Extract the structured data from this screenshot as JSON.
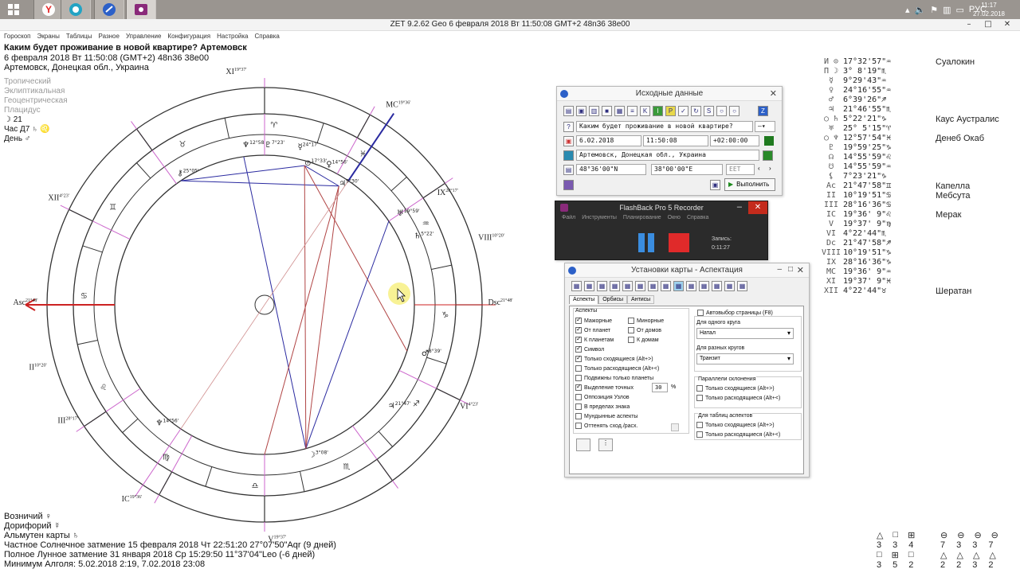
{
  "taskbar": {
    "start_icon": "windows-logo",
    "apps": [
      "yandex-browser",
      "globe-app",
      "zet-app",
      "flashback-recorder"
    ],
    "tray_lang": "РУС",
    "time": "11:17",
    "date": "27.02.2018"
  },
  "window": {
    "title": "ZET 9.2.62 Geo     6 февраля 2018  Вт  11:50:08 GMT+2 48n36  38e00",
    "minimize": "–",
    "maximize": "□",
    "close": "✕"
  },
  "menu": [
    "Гороскоп",
    "Экраны",
    "Таблицы",
    "Разное",
    "Управление",
    "Конфигурация",
    "Настройка",
    "Справка"
  ],
  "header": {
    "question": "Каким будет проживание в новой квартире? Артемовск",
    "datetime": "6 февраля 2018  Вт  11:50:08 (GMT+2) 48n36  38e00",
    "place": "Артемовск, Донецкая обл., Украина"
  },
  "settings_list": [
    "Тропический",
    "Эклиптикальная",
    "Геоцентрическая",
    "Плацидус"
  ],
  "info_list": [
    "☽  21",
    "Час Д7  ♄  ♌",
    "День  ♂"
  ],
  "bottom_list": [
    "Возничий  ♀",
    "Дорифорий  ☿",
    "Альмутен карты  ♄",
    "Частное Солнечное затмение 15 февраля 2018 Чт 22:51:20 27°07'50\"Aqr (9 дней)",
    "Полное Лунное затмение 31 января 2018 Ср 15:29:50 11°37'04\"Leo (-6 дней)",
    "Минимум Алголя: 5.02.2018  2:19,  7.02.2018 23:08"
  ],
  "wheel": {
    "houses": [
      {
        "label": "XI",
        "deg": "19°37'"
      },
      {
        "label": "MC",
        "deg": "19°36'"
      },
      {
        "label": "IX",
        "deg": "28°17'"
      },
      {
        "label": "VIII",
        "deg": "10°20'"
      },
      {
        "label": "Dsc",
        "deg": "21°48'"
      },
      {
        "label": "VI",
        "deg": "4°23'"
      },
      {
        "label": "V",
        "deg": "19°37'"
      },
      {
        "label": "IC",
        "deg": "19°36'"
      },
      {
        "label": "III",
        "deg": "28°17'"
      },
      {
        "label": "II",
        "deg": "10°20'"
      },
      {
        "label": "Asc",
        "deg": "21°48'"
      },
      {
        "label": "XII",
        "deg": "4°23'"
      }
    ],
    "planet_labels": [
      {
        "sym": "♆",
        "deg": "12°58"
      },
      {
        "sym": "♇",
        "deg": "7°23'"
      },
      {
        "sym": "☿",
        "deg": "24°17'"
      },
      {
        "sym": "♀",
        "deg": "14°56'"
      },
      {
        "sym": "⊙",
        "deg": "17°33'"
      },
      {
        "sym": "♃",
        "deg": "9°30'"
      },
      {
        "sym": "♅",
        "deg": "19°59'"
      },
      {
        "sym": "♄",
        "deg": "5°22'"
      },
      {
        "sym": "♂",
        "deg": "8°39'"
      },
      {
        "sym": "♃",
        "deg": "21°47'"
      },
      {
        "sym": "☽",
        "deg": "3°08'"
      },
      {
        "sym": "♆",
        "deg": "14°56'"
      },
      {
        "sym": "⚷",
        "deg": "25°05'"
      }
    ]
  },
  "planets": [
    {
      "sym": "И ⊙",
      "pos": "17°32'57\"♒",
      "star": "Суалокин"
    },
    {
      "sym": "П ☽",
      "pos": " 3° 8'19\"♏",
      "star": ""
    },
    {
      "sym": "☿",
      "pos": " 9°29'43\"♒",
      "star": ""
    },
    {
      "sym": "♀",
      "pos": "24°16'55\"♒",
      "star": ""
    },
    {
      "sym": "♂",
      "pos": " 6°39'26\"♐",
      "star": ""
    },
    {
      "sym": "♃",
      "pos": "21°46'55\"♏",
      "star": ""
    },
    {
      "sym": "○ ♄",
      "pos": " 5°22'21\"♑",
      "star": "Каус Аустралис"
    },
    {
      "sym": "♅",
      "pos": "25° 5'15\"♈",
      "star": ""
    },
    {
      "sym": "○ ♆",
      "pos": "12°57'54\"♓",
      "star": "Денеб Окаб"
    },
    {
      "sym": "♇",
      "pos": "19°59'25\"♑",
      "star": ""
    },
    {
      "sym": "☊",
      "pos": "14°55'59\"♌",
      "star": ""
    },
    {
      "sym": "☋",
      "pos": "14°55'59\"♒",
      "star": ""
    },
    {
      "sym": "⚸",
      "pos": " 7°23'21\"♑",
      "star": ""
    },
    {
      "sym": "Ac",
      "pos": "21°47'58\"♊",
      "star": "Капелла"
    },
    {
      "sym": "II",
      "pos": "10°19'51\"♋",
      "star": "Мебсута"
    },
    {
      "sym": "III",
      "pos": "28°16'36\"♋",
      "star": ""
    },
    {
      "sym": "IC",
      "pos": "19°36' 9\"♌",
      "star": "Мерак"
    },
    {
      "sym": "V",
      "pos": "19°37' 9\"♍",
      "star": ""
    },
    {
      "sym": "VI",
      "pos": " 4°22'44\"♏",
      "star": ""
    },
    {
      "sym": "Dc",
      "pos": "21°47'58\"♐",
      "star": ""
    },
    {
      "sym": "VIII",
      "pos": "10°19'51\"♑",
      "star": ""
    },
    {
      "sym": "IX",
      "pos": "28°16'36\"♑",
      "star": ""
    },
    {
      "sym": "MC",
      "pos": "19°36' 9\"♒",
      "star": ""
    },
    {
      "sym": "XI",
      "pos": "19°37' 9\"♓",
      "star": ""
    },
    {
      "sym": "XII",
      "pos": " 4°22'44\"♉",
      "star": "Шератан"
    }
  ],
  "counts": {
    "left_syms": [
      "△",
      "□",
      "⊞"
    ],
    "left_row1": [
      "3",
      "3",
      "4"
    ],
    "left_row2": [
      "3",
      "5",
      "2"
    ],
    "right_syms": [
      "⊖",
      "⊖",
      "⊖",
      "⊖"
    ],
    "right_row1": [
      "7",
      "3",
      "3",
      "7"
    ],
    "right_row2": [
      "2",
      "2",
      "3",
      "2"
    ],
    "left_syms2": [
      "□",
      "⊞",
      "□"
    ],
    "right_syms2": [
      "△",
      "△",
      "△",
      "△"
    ]
  },
  "dlg_source": {
    "title": "Исходные данные",
    "question": "Каким будет проживание в новой квартире?",
    "date": "6.02.2018",
    "time": "11:50:08",
    "tz": "+02:00:00",
    "place": "Артемовск, Донецкая обл., Украина",
    "lat": "48°36'00\"N",
    "lon": "38°00'00\"E",
    "tzname": "EET",
    "run_button": "Выполнить"
  },
  "dlg_flashback": {
    "title": "FlashBack Pro 5 Recorder",
    "menu": [
      "Файл",
      "Инструменты",
      "Планирование",
      "Окно",
      "Справка"
    ],
    "status_label": "Запись:",
    "time": "0:11:27"
  },
  "dlg_aspects": {
    "title": "Установки карты - Аспектация",
    "tabs": [
      "Аспекты",
      "Орбисы",
      "Антисы"
    ],
    "group_label": "Аспекты",
    "left_checks": [
      {
        "label": "Мажорные",
        "on": true
      },
      {
        "label": "От планет",
        "on": true
      },
      {
        "label": "К планетам",
        "on": true
      },
      {
        "label": "Символ",
        "on": true
      },
      {
        "label": "Только сходящиеся  (Alt+>)",
        "on": true
      },
      {
        "label": "Только расходящиеся (Alt+<)",
        "on": false
      },
      {
        "label": "Подвижны только планеты",
        "on": false
      },
      {
        "label": "Выделение точных",
        "on": true
      },
      {
        "label": "Оппозиция Узлов",
        "on": false
      },
      {
        "label": "В пределах знака",
        "on": false
      },
      {
        "label": "Мундынные аспекты",
        "on": false
      },
      {
        "label": "Оттенять сход./расх.",
        "on": false
      }
    ],
    "mid_checks": [
      {
        "label": "Минорные",
        "on": false
      },
      {
        "label": "От домов",
        "on": false
      },
      {
        "label": "К домам",
        "on": false
      }
    ],
    "exact_value": "30",
    "exact_unit": "%",
    "autoselect": "Автовыбор страницы  (F8)",
    "one_circle_label": "Для одного круга",
    "one_circle_value": "Натал",
    "diff_circle_label": "Для разных кругов",
    "diff_circle_value": "Транзит",
    "parallels_label": "Параллели склонения",
    "parallels": [
      "Только сходящиеся  (Alt+>)",
      "Только расходящиеся (Alt+<)"
    ],
    "tables_label": "Для таблиц аспектов",
    "tables": [
      "Только сходящиеся  (Alt+>)",
      "Только расходящиеся (Alt+<)"
    ]
  },
  "colors": {
    "accent_red": "#cc2222",
    "house_pink": "#cc66cc",
    "aspect_blue": "#2a2aa0",
    "aspect_red": "#b04444"
  }
}
